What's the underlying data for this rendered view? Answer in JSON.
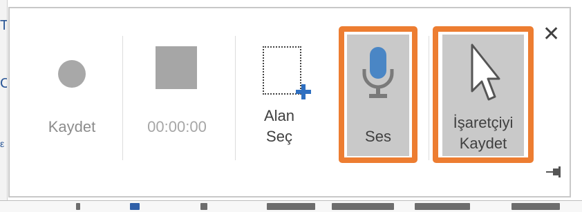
{
  "toolbar": {
    "record_label": "Kaydet",
    "timer_label": "00:00:00",
    "select_area_label_line1": "Alan",
    "select_area_label_line2": "Seç",
    "audio_label": "Ses",
    "record_pointer_label_line1": "İşaretçiyi",
    "record_pointer_label_line2": "Kaydet"
  },
  "background": {
    "left_chars": [
      "T",
      "C",
      "ε"
    ]
  },
  "colors": {
    "highlight": "#ed7d31",
    "mic_blue": "#4a86c5",
    "disabled_text": "#8c8c8c",
    "button_face": "#c9c9c9"
  },
  "icons": [
    "record-dot-icon",
    "stop-square-icon",
    "select-area-icon",
    "microphone-icon",
    "mouse-pointer-icon",
    "close-icon",
    "pin-icon"
  ]
}
